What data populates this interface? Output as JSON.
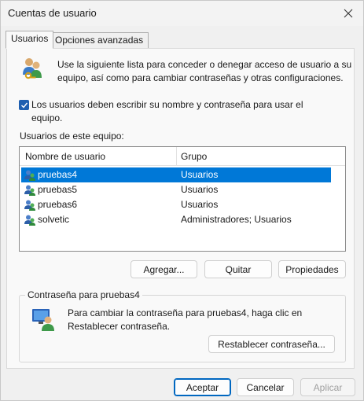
{
  "window": {
    "title": "Cuentas de usuario"
  },
  "tabs": [
    {
      "label": "Usuarios",
      "active": true
    },
    {
      "label": "Opciones avanzadas",
      "active": false
    }
  ],
  "intro": {
    "text": "Use la siguiente lista para conceder o denegar acceso de usuario a su equipo, así como para cambiar contraseñas y otras configuraciones."
  },
  "require_login": {
    "checked": true,
    "label": "Los usuarios deben escribir su nombre y contraseña para usar el equipo."
  },
  "users": {
    "label": "Usuarios de este equipo:",
    "columns": [
      "Nombre de usuario",
      "Grupo"
    ],
    "rows": [
      {
        "name": "pruebas4",
        "group": "Usuarios",
        "selected": true
      },
      {
        "name": "pruebas5",
        "group": "Usuarios",
        "selected": false
      },
      {
        "name": "pruebas6",
        "group": "Usuarios",
        "selected": false
      },
      {
        "name": "solvetic",
        "group": "Administradores; Usuarios",
        "selected": false
      }
    ]
  },
  "actions": {
    "add": "Agregar...",
    "remove": "Quitar",
    "properties": "Propiedades"
  },
  "password": {
    "group_title": "Contraseña para pruebas4",
    "text": "Para cambiar la contraseña para pruebas4, haga clic en Restablecer contraseña.",
    "reset": "Restablecer contraseña..."
  },
  "footer": {
    "ok": "Aceptar",
    "cancel": "Cancelar",
    "apply": "Aplicar"
  },
  "colors": {
    "accent": "#0067c0",
    "selection": "#0078d7"
  },
  "icons": [
    "close-icon",
    "users-icon",
    "checkbox-checked-icon",
    "user-icon",
    "password-icon"
  ]
}
